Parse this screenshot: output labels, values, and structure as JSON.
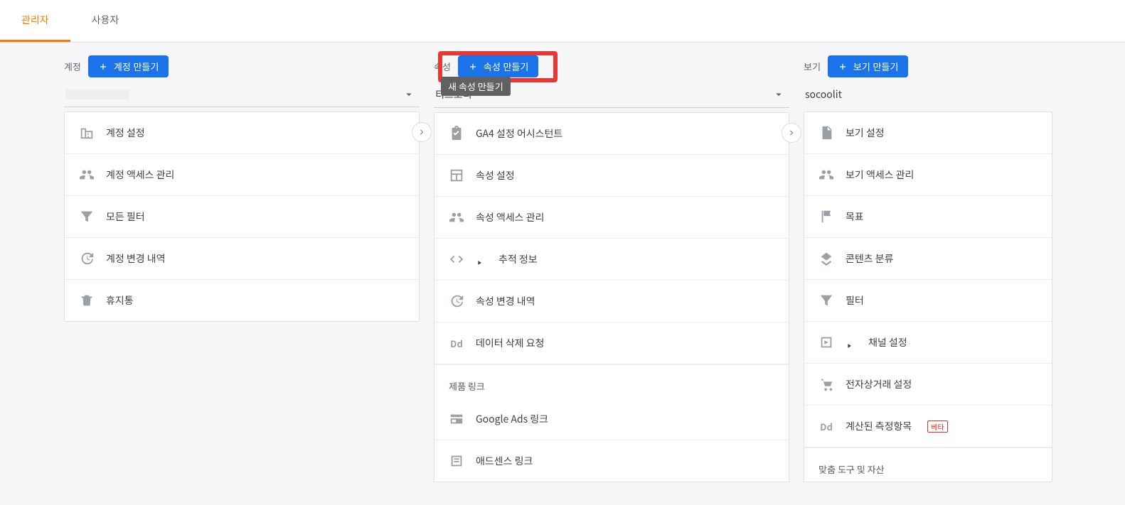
{
  "tabs": {
    "admin": "관리자",
    "user": "사용자"
  },
  "account": {
    "label": "계정",
    "create_btn": "계정 만들기",
    "selector_value": "",
    "items": [
      "계정 설정",
      "계정 액세스 관리",
      "모든 필터",
      "계정 변경 내역",
      "휴지통"
    ]
  },
  "property": {
    "label": "속성",
    "create_btn": "속성 만들기",
    "tooltip": "새 속성 만들기",
    "selector_value": "티스토리",
    "items": [
      "GA4 설정 어시스턴트",
      "속성 설정",
      "속성 액세스 관리",
      "추적 정보",
      "속성 변경 내역",
      "데이터 삭제 요청"
    ],
    "section_product_links": "제품 링크",
    "product_link_items": [
      "Google Ads 링크",
      "애드센스 링크"
    ]
  },
  "view": {
    "label": "보기",
    "create_btn": "보기 만들기",
    "selector_value": "socoolit",
    "items": [
      "보기 설정",
      "보기 액세스 관리",
      "목표",
      "콘텐츠 분류",
      "필터",
      "채널 설정",
      "전자상거래 설정",
      "계산된 측정항목"
    ],
    "beta_badge": "베타",
    "section_custom": "맞춤 도구 및 자산"
  }
}
